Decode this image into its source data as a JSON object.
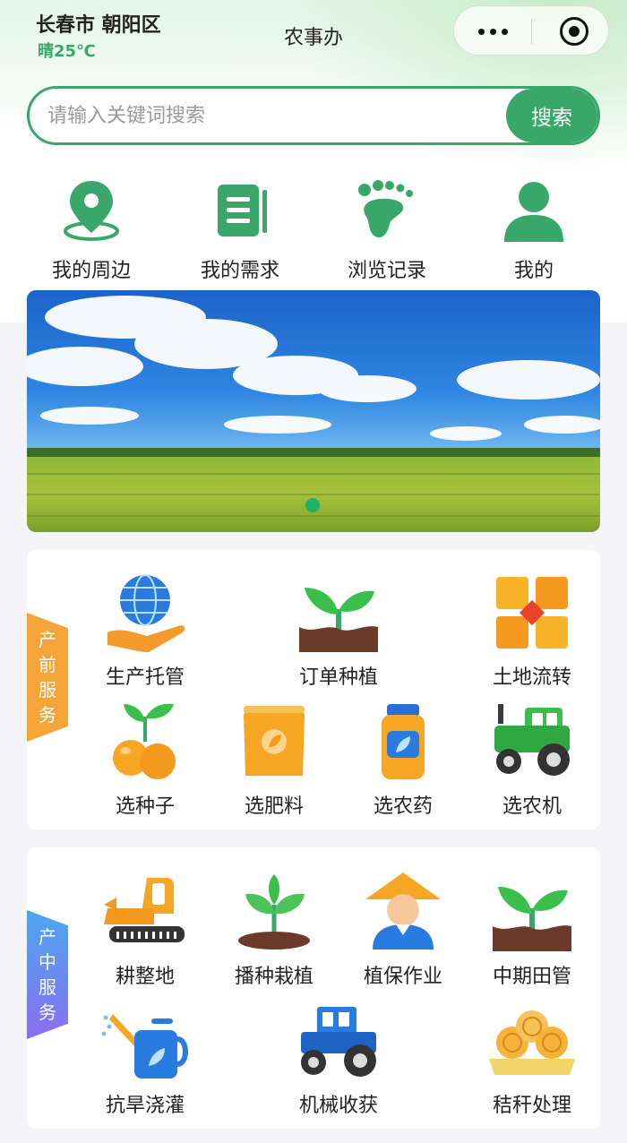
{
  "header": {
    "location": "长春市 朝阳区",
    "weather": "晴25℃",
    "title": "农事办"
  },
  "search": {
    "placeholder": "请输入关键词搜索",
    "button_label": "搜索"
  },
  "quick_links": [
    {
      "label": "我的周边",
      "icon": "location-pin-icon"
    },
    {
      "label": "我的需求",
      "icon": "document-list-icon"
    },
    {
      "label": "浏览记录",
      "icon": "footprint-icon"
    },
    {
      "label": "我的",
      "icon": "user-icon"
    }
  ],
  "banner": {
    "image": "rice-field-blue-sky",
    "slides": 1,
    "active_slide": 1
  },
  "pre_production": {
    "tab_label": "产前服务",
    "items": [
      {
        "label": "生产托管",
        "icon": "globe-hand-icon"
      },
      {
        "label": "订单种植",
        "icon": "sprout-soil-icon"
      },
      {
        "label": "土地流转",
        "icon": "land-blocks-icon"
      },
      {
        "label": "选种子",
        "icon": "seed-fruit-icon"
      },
      {
        "label": "选肥料",
        "icon": "fertilizer-bag-icon"
      },
      {
        "label": "选农药",
        "icon": "pesticide-bottle-icon"
      },
      {
        "label": "选农机",
        "icon": "tractor-icon"
      }
    ]
  },
  "mid_production": {
    "tab_label": "产中服务",
    "items": [
      {
        "label": "耕整地",
        "icon": "excavator-icon"
      },
      {
        "label": "播种栽植",
        "icon": "seedling-icon"
      },
      {
        "label": "植保作业",
        "icon": "farmer-icon"
      },
      {
        "label": "中期田管",
        "icon": "sprout-soil-icon"
      },
      {
        "label": "抗旱浇灌",
        "icon": "watering-can-icon"
      },
      {
        "label": "机械收获",
        "icon": "harvester-tractor-icon"
      },
      {
        "label": "秸秆处理",
        "icon": "hay-bales-icon"
      }
    ]
  },
  "colors": {
    "brand_green": "#3aa76a",
    "tab_orange": "#f4a539",
    "tab_blue": "#5aa0ef"
  }
}
